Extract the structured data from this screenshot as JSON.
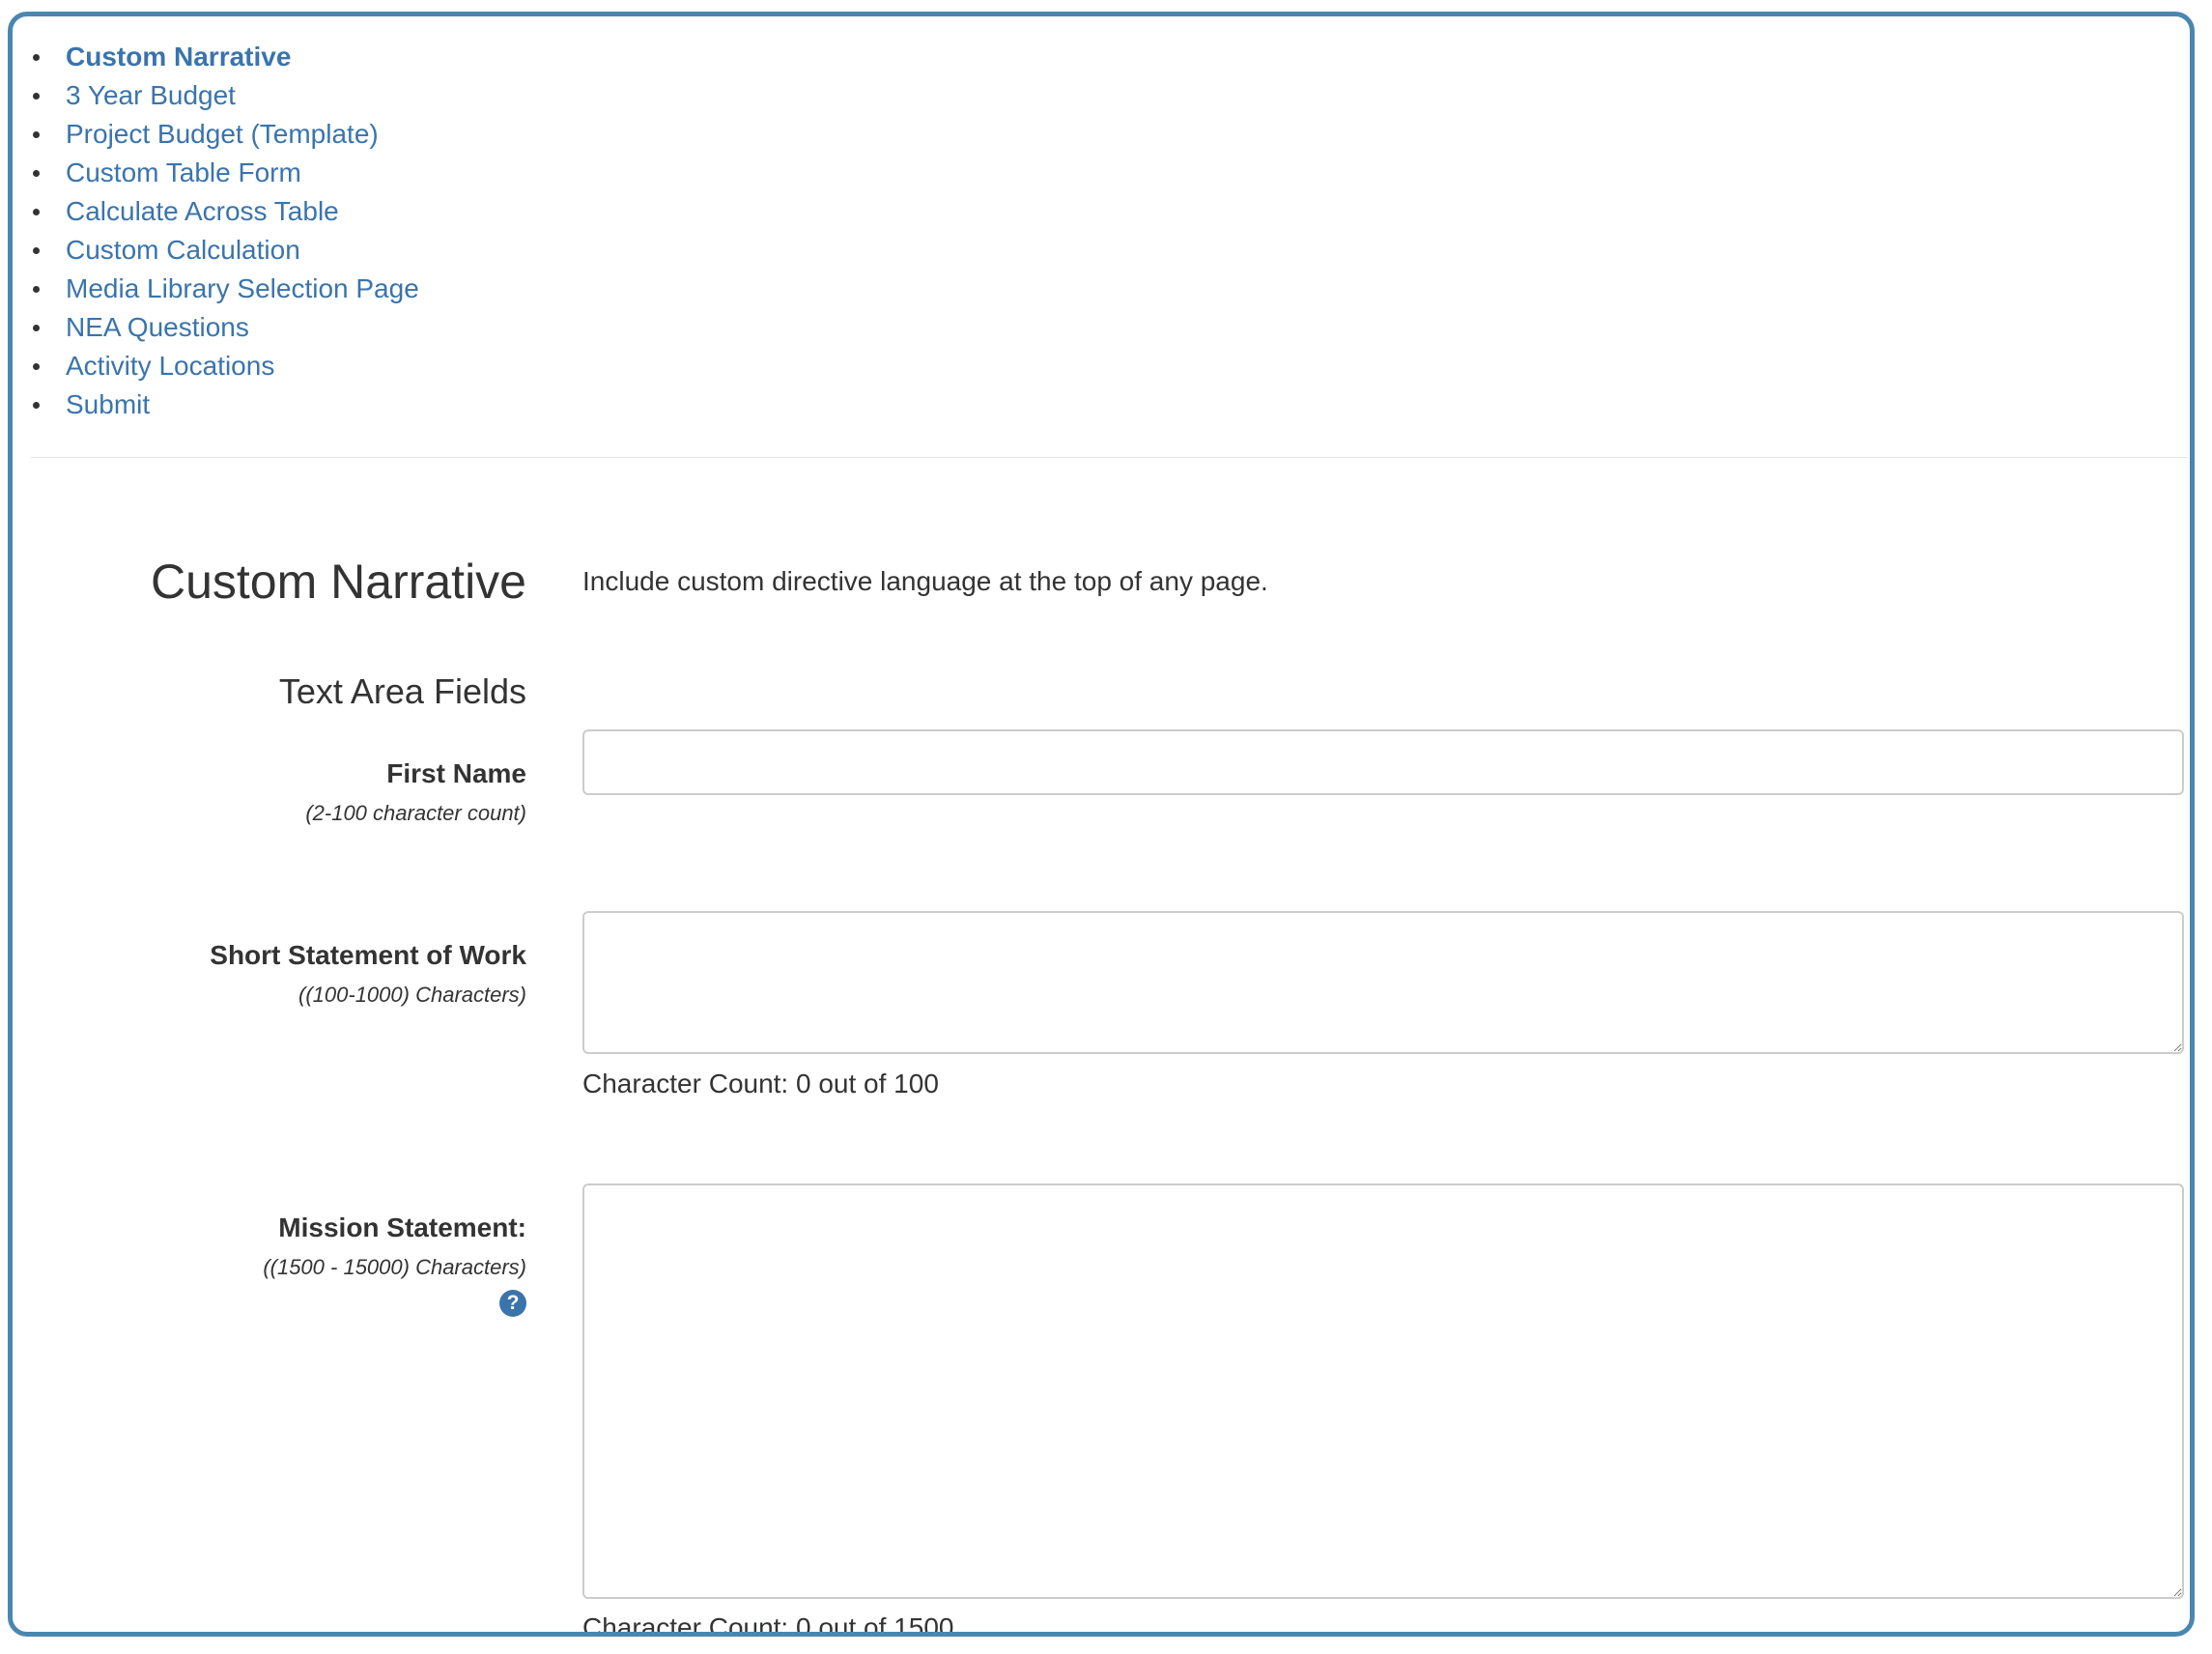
{
  "nav": {
    "items": [
      {
        "label": "Custom Narrative",
        "active": true
      },
      {
        "label": "3 Year Budget",
        "active": false
      },
      {
        "label": "Project Budget (Template)",
        "active": false
      },
      {
        "label": "Custom Table Form",
        "active": false
      },
      {
        "label": "Calculate Across Table",
        "active": false
      },
      {
        "label": "Custom Calculation",
        "active": false
      },
      {
        "label": "Media Library Selection Page",
        "active": false
      },
      {
        "label": "NEA Questions",
        "active": false
      },
      {
        "label": "Activity Locations",
        "active": false
      },
      {
        "label": "Submit",
        "active": false
      }
    ]
  },
  "page": {
    "title": "Custom Narrative",
    "description": "Include custom directive language at the top of any page."
  },
  "section": {
    "title": "Text Area Fields"
  },
  "fields": {
    "first_name": {
      "label": "First Name",
      "hint": "(2-100 character count)",
      "value": ""
    },
    "statement_of_work": {
      "label": "Short Statement of Work",
      "hint": "((100-1000) Characters)",
      "value": "",
      "char_count": "Character Count: 0 out of 100"
    },
    "mission_statement": {
      "label": "Mission Statement:",
      "hint": "((1500 - 15000) Characters)",
      "value": "",
      "char_count": "Character Count: 0 out of 1500",
      "help_glyph": "?"
    }
  },
  "colors": {
    "frame_border": "#4a87b0",
    "link": "#3a74ad",
    "text": "#333333",
    "input_border": "#cccccc"
  },
  "icons": {
    "help": "question-circle-icon",
    "resize": "resize-grip-icon"
  }
}
